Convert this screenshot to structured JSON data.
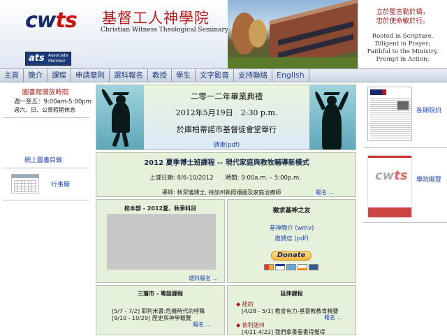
{
  "header": {
    "logo_text_a": "cw",
    "logo_text_b": "ts",
    "ats_mark": "ats",
    "ats_label": "Associate Member",
    "title_zh": "基督工人神學院",
    "title_en": "Christian Witness Theological Seminary",
    "motto_zh_1": "立於聖言勤於禱，",
    "motto_zh_2": "忠於使命敏於行。",
    "motto_en_1": "Rooted in Scripture,",
    "motto_en_2": "Diligent in Prayer;",
    "motto_en_3": "Faithful to the Ministry,",
    "motto_en_4": "Prompt in Action;"
  },
  "nav": {
    "items": [
      "主頁",
      "簡介",
      "課程",
      "申請章則",
      "選科報名",
      "教授",
      "學生",
      "文字影音",
      "支持聯絡",
      "English"
    ]
  },
  "left": {
    "lib_title": "圖書館開放時間",
    "lib_line1": "週一至五：9:00am-5:00pm",
    "lib_line2": "週六、日、公眾假期休息",
    "catalog_link": "網上圖書目錄",
    "calendar_link": "行事曆"
  },
  "graduation": {
    "title": "二零一二年畢業典禮",
    "date": "2012年5月19日　2:30 p.m.",
    "place": "於庫柏蒂諾市基督徒會堂舉行",
    "invite_link": "請柬(pdf)"
  },
  "dmin": {
    "title": "2012 夏季博士班課程 -- 現代家庭與教牧輔導新模式",
    "dates": "上課日期: 8/6-10/2012　　時間: 9:00a.m. – 5:00p.m.",
    "teacher": "導師: 林潔儀博士, 持加州執照婚姻及家庭治療師",
    "more": "報名 ..."
  },
  "main_campus": {
    "title": "校本部 - 2012夏、秋季科目",
    "register": "選科報名 ..."
  },
  "friends": {
    "title": "徵求基神之友",
    "intro_link": "基神簡介 (wmv)",
    "letter_link": "邀請信 (pdf)",
    "donate_label": "Donate"
  },
  "sf_cantonese": {
    "title": "三藩市 - 粵語課程",
    "course1": "[5/7 - 7/2] 耶利米書:危機時代的呼聲",
    "course2": "[9/10 - 10/29] 歷史與神學概覽",
    "more": "報名 ..."
  },
  "extension": {
    "title": "延伸課程",
    "region1": "◆ 紐約",
    "course1": "[4/28 - 5/1] 教會有力-基督教教育精要",
    "more1": "報名 ...",
    "region2": "◆ 依利諾州",
    "course2": "[4/21-4/22] 我們拿書看書得覺得"
  },
  "right": {
    "newsletter_link": "各期院訊",
    "overview_link": "學院概覽"
  },
  "colors": {
    "nav_text": "#1a3a7a",
    "accent_red": "#b21b1b",
    "panel_green": "#e6f1db",
    "link_blue": "#2244aa"
  }
}
